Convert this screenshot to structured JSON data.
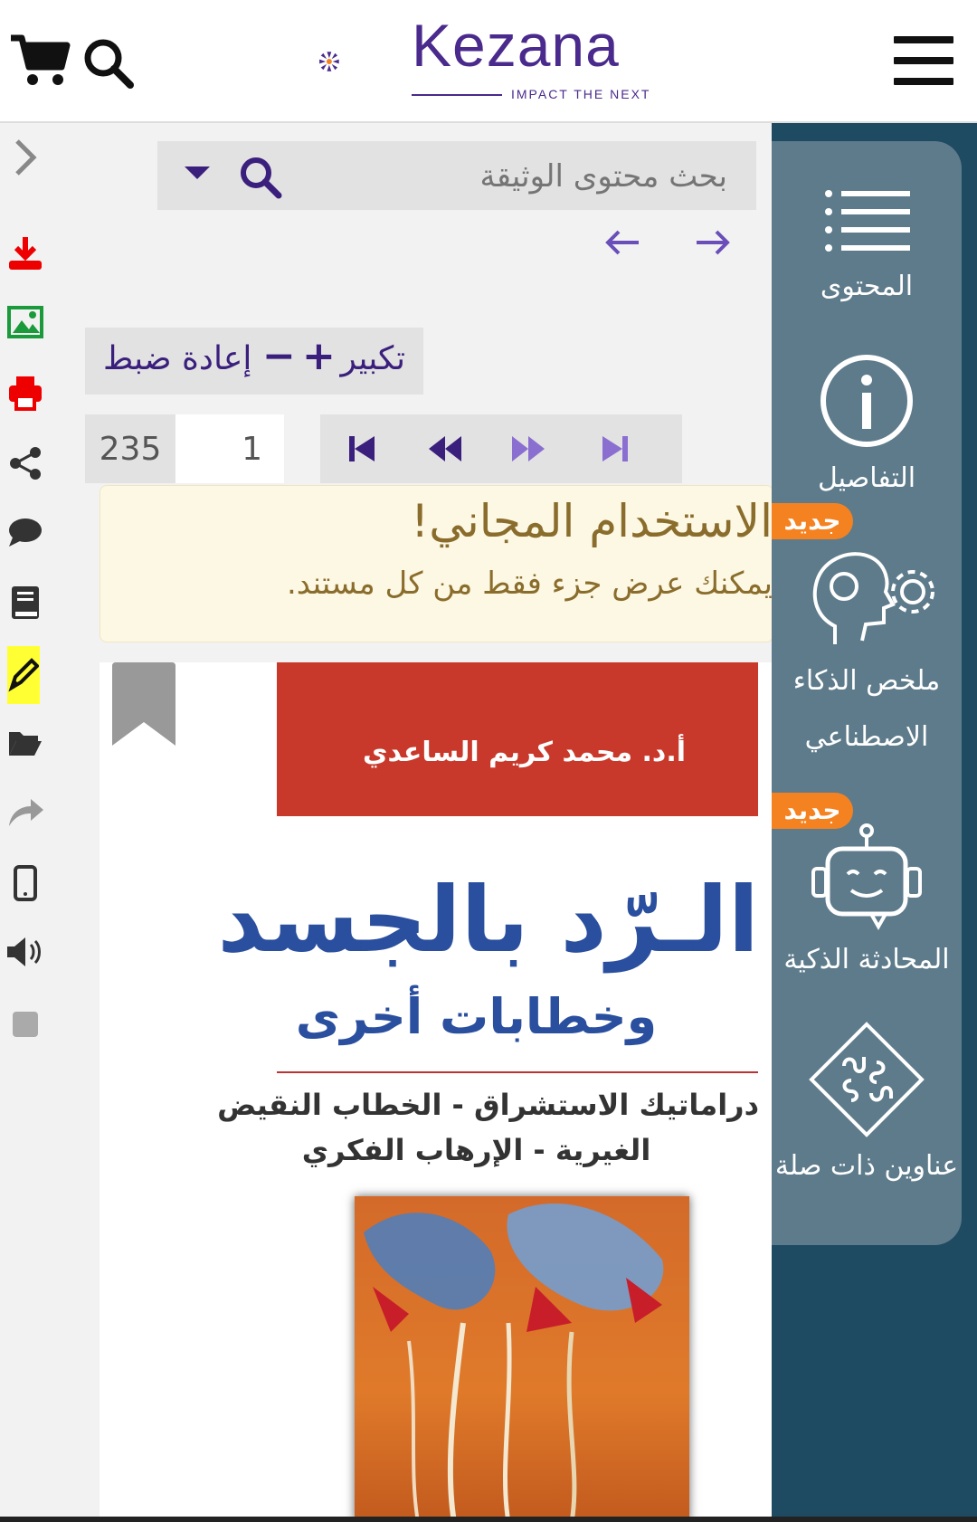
{
  "header": {
    "brand": "Kezana",
    "tagline": "IMPACT THE NEXT"
  },
  "left_toolbar": {
    "icons": [
      "chevron-right-icon",
      "download-icon",
      "image-icon",
      "print-icon",
      "share-icon",
      "comment-icon",
      "book-icon",
      "pencil-icon",
      "folder-icon",
      "redo-icon",
      "mobile-icon",
      "speaker-icon",
      "square-icon"
    ]
  },
  "search": {
    "placeholder": "بحث محتوى الوثيقة"
  },
  "zoom": {
    "label": "تكبير",
    "plus": "+",
    "minus": "−",
    "reset": "إعادة ضبط"
  },
  "pagination": {
    "current": "1",
    "total": "235"
  },
  "notice": {
    "title": "الاستخدام المجاني!",
    "body": "يمكنك عرض جزء فقط من كل مستند."
  },
  "document": {
    "author": "أ.د. محمد كريم الساعدي",
    "title": "الـرّد بالجسد",
    "subtitle": "وخطابات أخرى",
    "line1": "دراماتيك الاستشراق - الخطاب النقيض",
    "line2": "الغيرية - الإرهاب الفكري"
  },
  "right_panel": {
    "items": [
      {
        "label": "المحتوى",
        "icon": "list-icon"
      },
      {
        "label": "التفاصيل",
        "icon": "info-icon"
      },
      {
        "label": "ملخص الذكاء",
        "label2": "الاصطناعي",
        "icon": "ai-head-icon",
        "badge": "جديد"
      },
      {
        "label": "المحادثة الذكية",
        "icon": "robot-icon",
        "badge": "جديد"
      },
      {
        "label": "عناوين ذات صلة",
        "icon": "puzzle-icon"
      }
    ]
  },
  "colors": {
    "brand_purple": "#4a2a8c",
    "accent_orange": "#f58220",
    "panel_dark": "#1e4a62",
    "panel_card": "#5e7b8b",
    "cover_red": "#c9392b",
    "title_blue": "#2a4f9e"
  }
}
